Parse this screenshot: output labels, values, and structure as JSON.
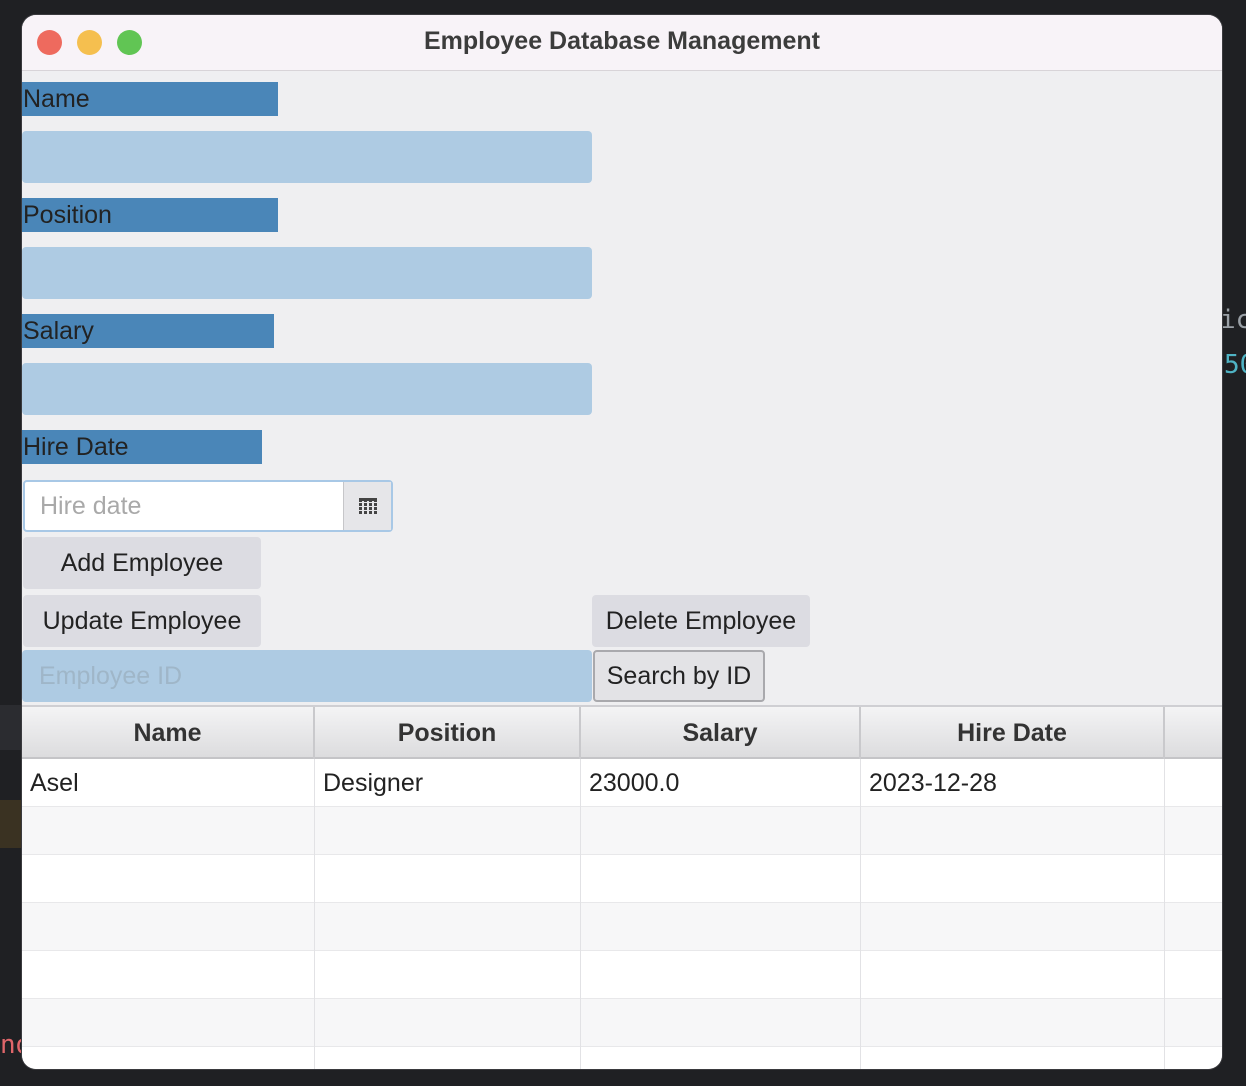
{
  "window": {
    "title": "Employee Database Management"
  },
  "form": {
    "name_label": "Name",
    "position_label": "Position",
    "salary_label": "Salary",
    "hire_date_label": "Hire Date",
    "hire_date_placeholder": "Hire date",
    "employee_id_placeholder": "Employee ID"
  },
  "buttons": {
    "add": "Add Employee",
    "update": "Update Employee",
    "delete": "Delete Employee",
    "search": "Search by ID"
  },
  "table": {
    "columns": [
      "Name",
      "Position",
      "Salary",
      "Hire Date"
    ],
    "rows": [
      [
        "Asel",
        "Designer",
        "23000.0",
        "2023-12-28"
      ]
    ]
  },
  "colors": {
    "label_bg": "#4a86b8",
    "field_bg": "#aecbe3",
    "button_bg": "#dcdce2"
  },
  "icons": {
    "calendar": "calendar-icon"
  }
}
